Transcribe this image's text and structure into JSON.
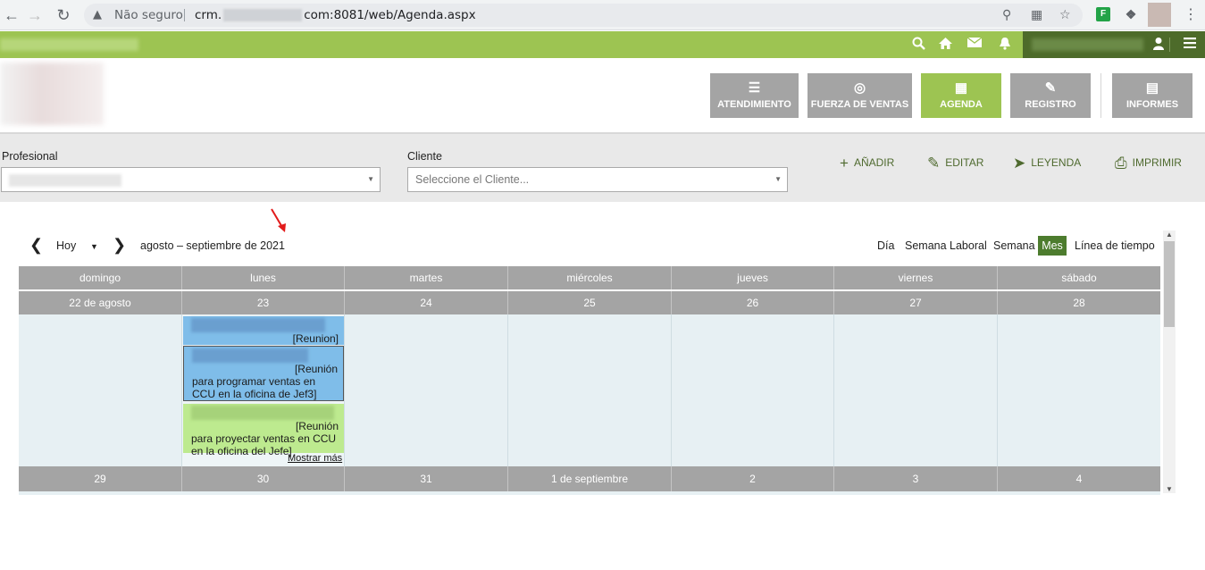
{
  "browser": {
    "security_label": "Não seguro",
    "url_prefix": "crm.",
    "url_suffix": "com:8081/web/Agenda.aspx"
  },
  "modules": [
    {
      "label": "ATENDIMIENTO",
      "icon": "checklist-icon",
      "active": false
    },
    {
      "label": "FUERZA DE VENTAS",
      "icon": "target-icon",
      "active": false
    },
    {
      "label": "AGENDA",
      "icon": "calendar-icon",
      "active": true
    },
    {
      "label": "REGISTRO",
      "icon": "edit-icon",
      "active": false
    },
    {
      "label": "INFORMES",
      "icon": "report-icon",
      "active": false
    }
  ],
  "filters": {
    "profesional_label": "Profesional",
    "cliente_label": "Cliente",
    "cliente_placeholder": "Seleccione el Cliente..."
  },
  "actions": {
    "add": "AÑADIR",
    "edit": "EDITAR",
    "legend": "LEYENDA",
    "print": "IMPRIMIR"
  },
  "calendar": {
    "today_label": "Hoy",
    "range_title": "agosto – septiembre de 2021",
    "views": [
      "Día",
      "Semana Laboral",
      "Semana",
      "Mes",
      "Línea de tiempo"
    ],
    "selected_view": "Mes",
    "weekdays": [
      "domingo",
      "lunes",
      "martes",
      "miércoles",
      "jueves",
      "viernes",
      "sábado"
    ],
    "week1": [
      "22 de agosto",
      "23",
      "24",
      "25",
      "26",
      "27",
      "28"
    ],
    "week2": [
      "29",
      "30",
      "31",
      "1 de septiembre",
      "2",
      "3",
      "4"
    ],
    "events": [
      {
        "tag": "[Reunion]",
        "text": "",
        "color": "#7fbde9"
      },
      {
        "tag": "[Reunión",
        "text": "para programar ventas en CCU en la oficina de Jef3]",
        "color": "#7fbde9"
      },
      {
        "tag": "[Reunión",
        "text": "para proyectar ventas en CCU en la oficina del Jefe]",
        "color": "#bdea8f"
      }
    ],
    "more_label": "Mostrar más"
  },
  "colors": {
    "app_green": "#9dc452",
    "dark_green": "#4d6b2a",
    "module_gray": "#a4a4a4",
    "event_blue": "#7fbde9",
    "event_green": "#bdea8f"
  }
}
